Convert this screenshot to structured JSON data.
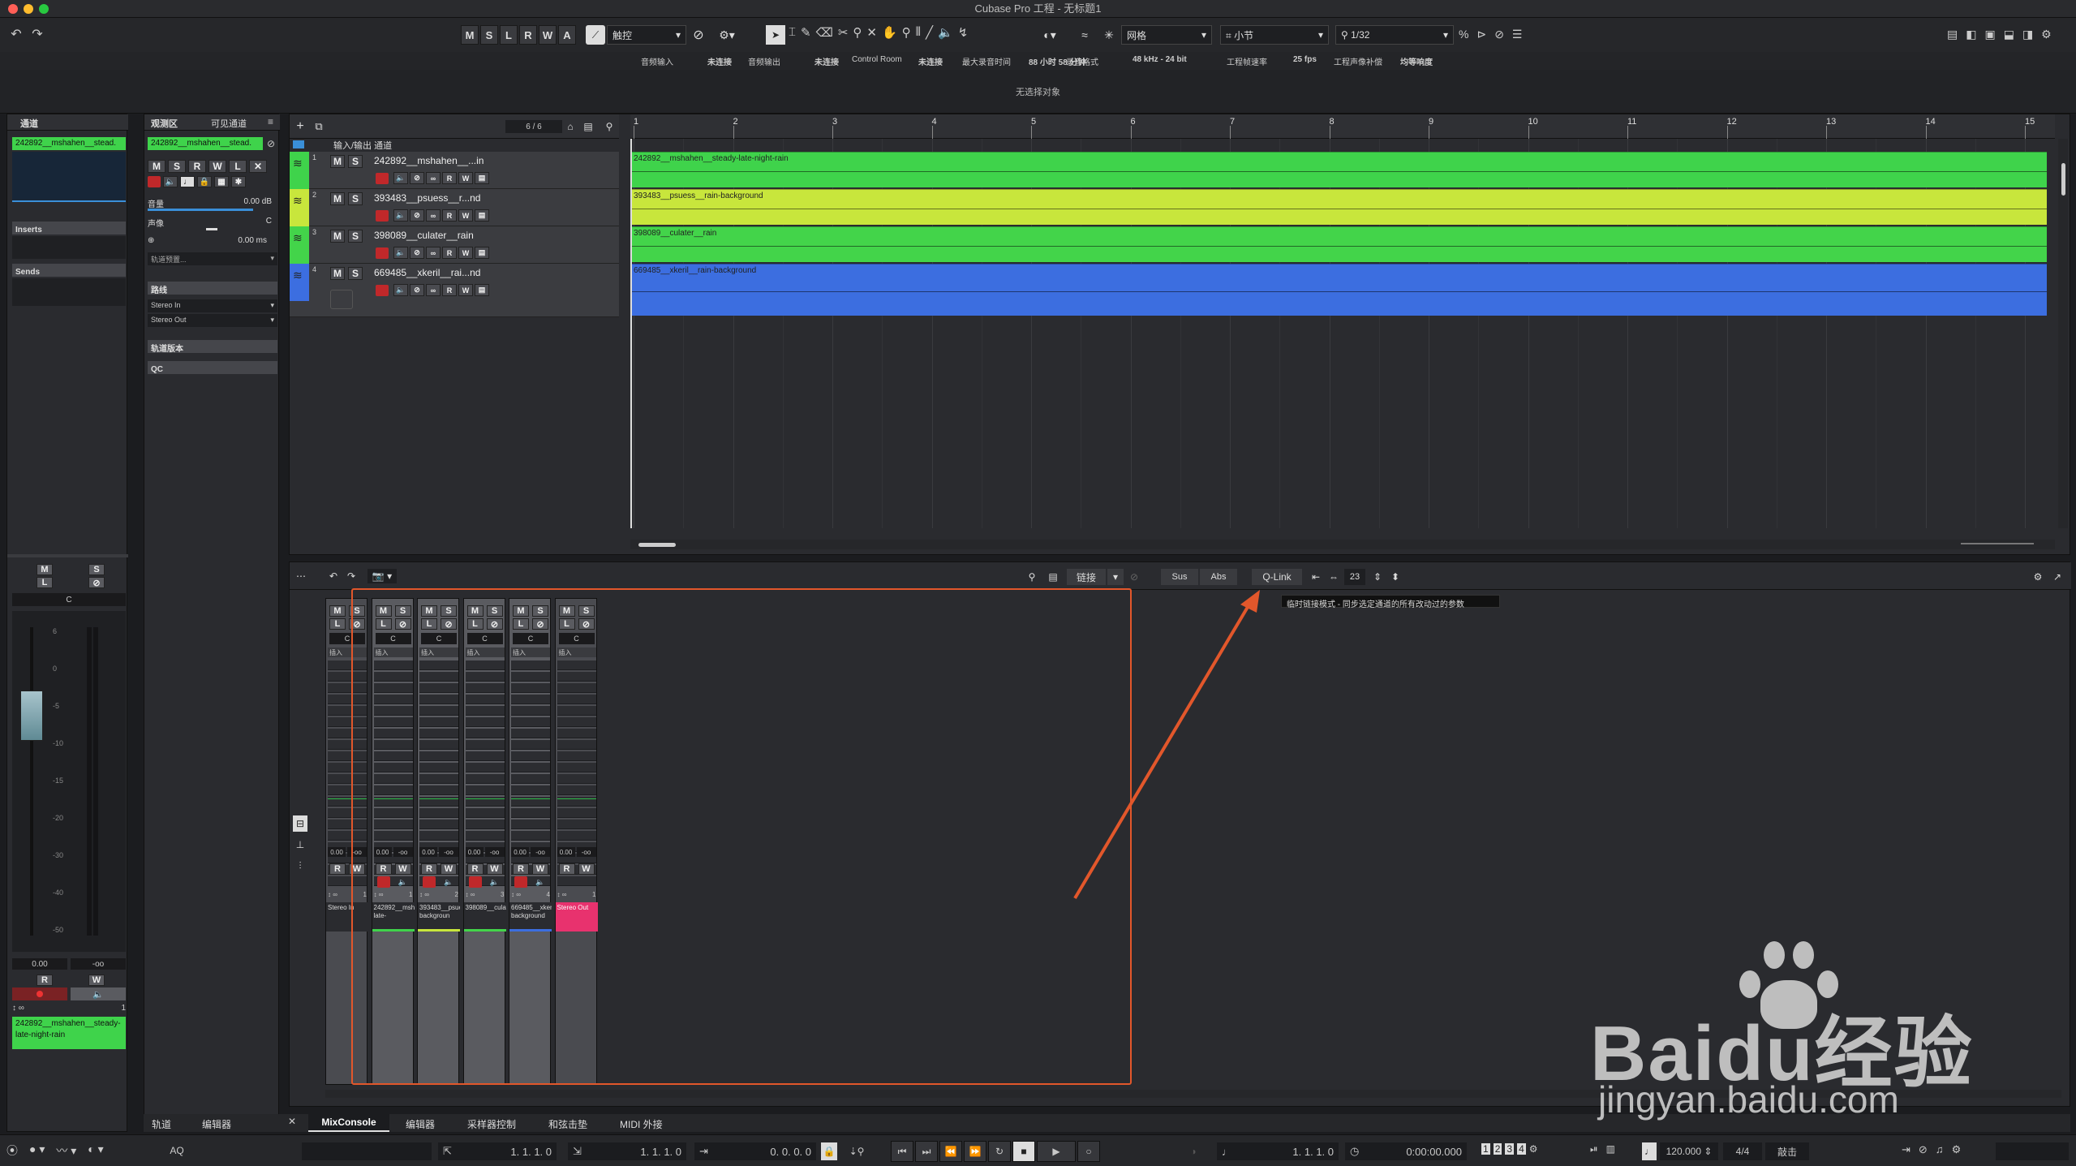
{
  "window": {
    "title": "Cubase Pro 工程 - 无标题1"
  },
  "toolbar": {
    "automation_buttons": [
      "M",
      "S",
      "L",
      "R",
      "W",
      "A"
    ],
    "automation_mode": "触控",
    "grid_type": "网格",
    "grid_unit": "小节",
    "quantize": "1/32"
  },
  "infoline": {
    "items": [
      {
        "label": "音频输入",
        "value": "未连接"
      },
      {
        "label": "音频输出",
        "value": "未连接"
      },
      {
        "label": "Control Room",
        "value": "未连接"
      },
      {
        "label": "最大录音时间",
        "value": "88 小时 58 分钟"
      },
      {
        "label": "录音格式",
        "value": "48 kHz - 24 bit"
      },
      {
        "label": "工程帧速率",
        "value": "25 fps"
      },
      {
        "label": "工程声像补偿",
        "value": "均等响度"
      }
    ]
  },
  "statusline": {
    "text": "无选择对象"
  },
  "left_zone": {
    "tab": "通道",
    "channel_name": "242892__mshahen__stead.",
    "inserts_label": "Inserts",
    "sends_label": "Sends",
    "fader_value": "0.00",
    "fader_value2": "-oo",
    "bottom_name": "242892__mshahen__steady-late-night-rain",
    "pan": "C",
    "ms": [
      "M",
      "S"
    ],
    "lo": [
      "L",
      "⊘"
    ],
    "rw": [
      "R",
      "W"
    ],
    "scale": [
      "6",
      "0",
      "-5",
      "-10",
      "-15",
      "-20",
      "-30",
      "-40",
      "-50"
    ]
  },
  "inspector": {
    "tabs": [
      "观测区",
      "可见通道"
    ],
    "track_name": "242892__mshahen__stead.",
    "buttons": [
      "M",
      "S",
      "R",
      "W",
      "L",
      "✕"
    ],
    "volume_label": "音量",
    "volume_value": "0.00 dB",
    "pan_label": "声像",
    "pan_value": "C",
    "delay_value": "0.00 ms",
    "preset": "轨道预置...",
    "routing_label": "路线",
    "routing_in": "Stereo In",
    "routing_out": "Stereo Out",
    "versions_label": "轨道版本",
    "qc_label": "QC"
  },
  "project": {
    "track_count": "6 / 6",
    "folder_name": "输入/输出 通道",
    "tracks": [
      {
        "num": "1",
        "name": "242892__mshahen__...in",
        "clip": "242892__mshahen__steady-late-night-rain",
        "color": "#3fd34b"
      },
      {
        "num": "2",
        "name": "393483__psuess__r...nd",
        "clip": "393483__psuess__rain-background",
        "color": "#c8e63c"
      },
      {
        "num": "3",
        "name": "398089__culater__rain",
        "clip": "398089__culater__rain",
        "color": "#43d44a"
      },
      {
        "num": "4",
        "name": "669485__xkeril__rai...nd",
        "clip": "669485__xkeril__rain-background",
        "color": "#3c6ee0"
      }
    ],
    "bars": [
      "1",
      "2",
      "3",
      "4",
      "5",
      "6",
      "7",
      "8",
      "9",
      "10",
      "11",
      "12",
      "13",
      "14",
      "15"
    ]
  },
  "mixconsole": {
    "toolbar": {
      "link": "链接",
      "sus": "Sus",
      "abs": "Abs",
      "qlink": "Q-Link",
      "count": "23"
    },
    "tooltip": "临时链接模式 - 同步选定通道的所有改动过的参数",
    "inserts_label": "插入",
    "channels": [
      {
        "name": "Stereo In",
        "num": "1",
        "value": "0.00",
        "value2": "-oo",
        "color": ""
      },
      {
        "name": "242892__mshahen__steady-late-",
        "num": "1",
        "value": "0.00",
        "value2": "-oo",
        "color": "#3fd34b"
      },
      {
        "name": "393483__psuess__rain-backgroun",
        "num": "2",
        "value": "0.00",
        "value2": "-oo",
        "color": "#c8e63c"
      },
      {
        "name": "398089__culater__rain",
        "num": "3",
        "value": "0.00",
        "value2": "-oo",
        "color": "#43d44a"
      },
      {
        "name": "669485__xkeril__rain-background",
        "num": "4",
        "value": "0.00",
        "value2": "-oo",
        "color": "#3c6ee0"
      },
      {
        "name": "Stereo Out",
        "num": "1",
        "value": "0.00",
        "value2": "-oo",
        "color": "#e8326e"
      }
    ]
  },
  "bottom_tabs": {
    "left": [
      "轨道",
      "编辑器"
    ],
    "right": [
      "MixConsole",
      "编辑器",
      "采样器控制",
      "和弦击垫",
      "MIDI 外接"
    ]
  },
  "transport": {
    "aq": "AQ",
    "left_locator": "1. 1. 1.  0",
    "right_locator": "1. 1. 1.  0",
    "punch": "0. 0. 0.  0",
    "position_bars": "1. 1. 1.  0",
    "position_time": "0:00:00.000",
    "tempo": "120.000",
    "signature": "4/4",
    "click": "敲击"
  },
  "watermark": {
    "brand": "Baidu经验",
    "url": "jingyan.baidu.com"
  }
}
